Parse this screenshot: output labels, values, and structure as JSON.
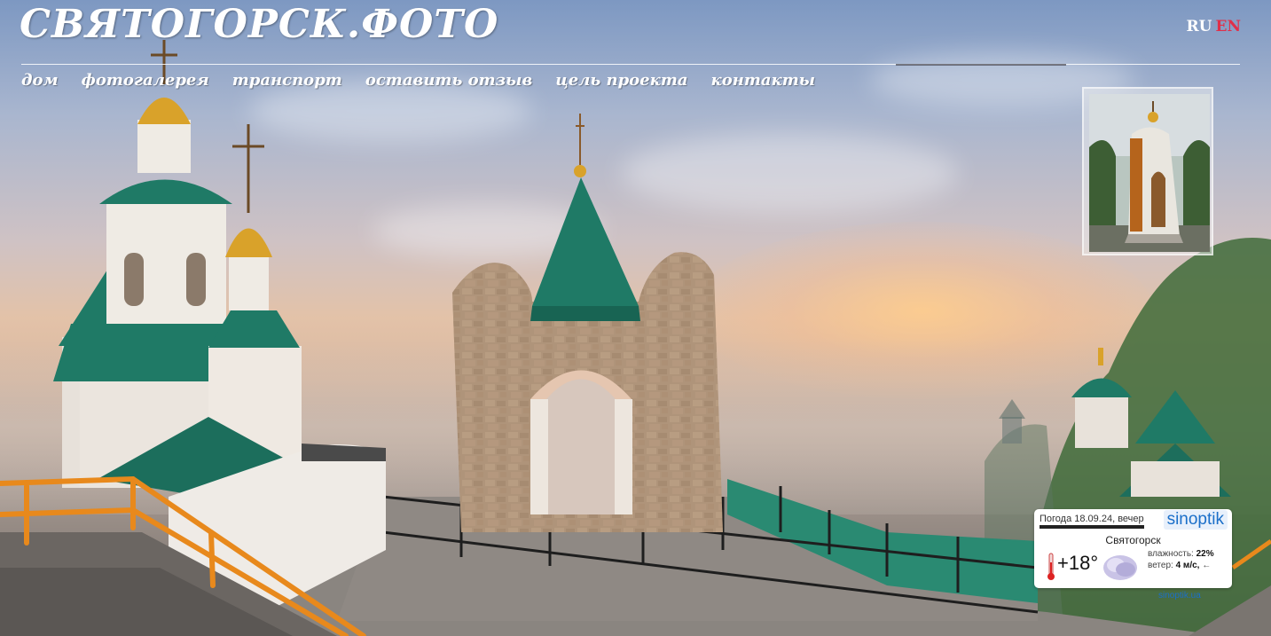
{
  "site": {
    "title": "СВЯТОГОРСК.ФОТО"
  },
  "lang": {
    "ru": "RU",
    "en": "EN"
  },
  "nav": {
    "items": [
      {
        "label": "дом"
      },
      {
        "label": "фотогалерея"
      },
      {
        "label": "транспорт"
      },
      {
        "label": "оставить отзыв"
      },
      {
        "label": "цель проекта"
      },
      {
        "label": "контакты"
      }
    ]
  },
  "weather": {
    "date_label": "Погода 18.09.24, вечер",
    "logo": "sinoptik",
    "city": "Святогорск",
    "temperature": "+18°",
    "humidity_label": "влажность:",
    "humidity_value": "22%",
    "wind_label": "ветер:",
    "wind_value": "4 м/с,",
    "wind_arrow": "←",
    "source_link": "sinoptik.ua",
    "icon": "cloudy-icon"
  },
  "colors": {
    "accent_red": "#e0304a",
    "brand_blue": "#1b6fc9",
    "dome_green": "#1f7a66",
    "gold": "#d9a22a",
    "railing_orange": "#e8891c"
  }
}
